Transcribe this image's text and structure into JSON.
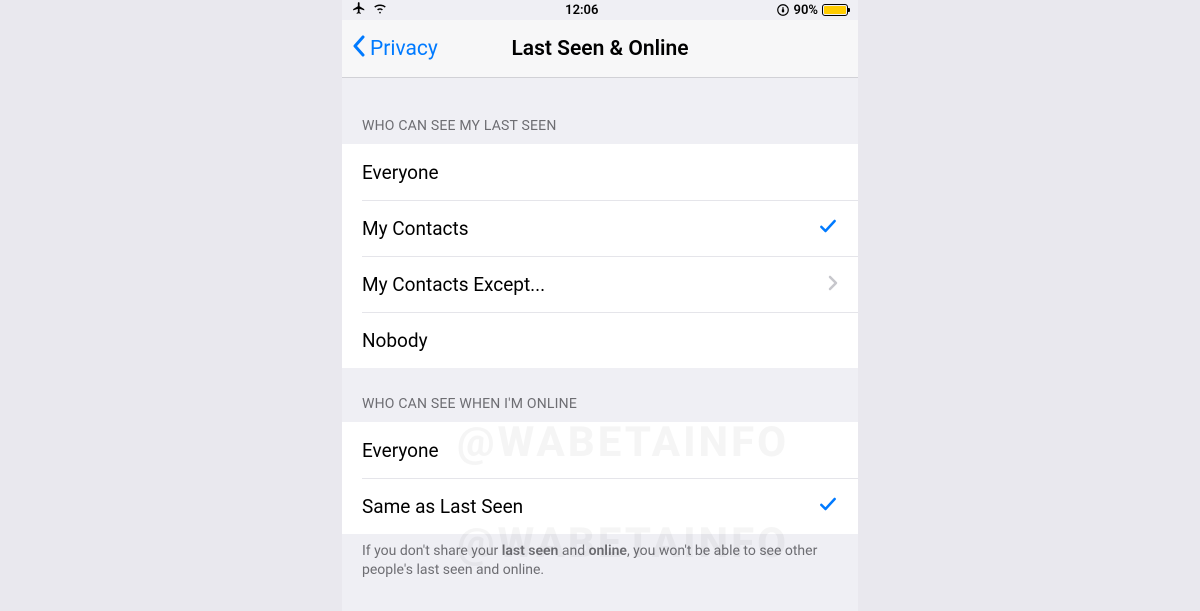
{
  "statusBar": {
    "time": "12:06",
    "batteryPercent": "90%"
  },
  "nav": {
    "backLabel": "Privacy",
    "title": "Last Seen & Online"
  },
  "section1": {
    "header": "WHO CAN SEE MY LAST SEEN",
    "options": {
      "everyone": "Everyone",
      "myContacts": "My Contacts",
      "myContactsExcept": "My Contacts Except...",
      "nobody": "Nobody"
    },
    "selected": "myContacts"
  },
  "section2": {
    "header": "WHO CAN SEE WHEN I'M ONLINE",
    "options": {
      "everyone": "Everyone",
      "sameAsLastSeen": "Same as Last Seen"
    },
    "selected": "sameAsLastSeen"
  },
  "footer": {
    "prefix": "If you don't share your ",
    "bold1": "last seen",
    "mid": " and ",
    "bold2": "online",
    "suffix": ", you won't be able to see other people's last seen and online."
  },
  "watermark": "@WABETAINFO"
}
